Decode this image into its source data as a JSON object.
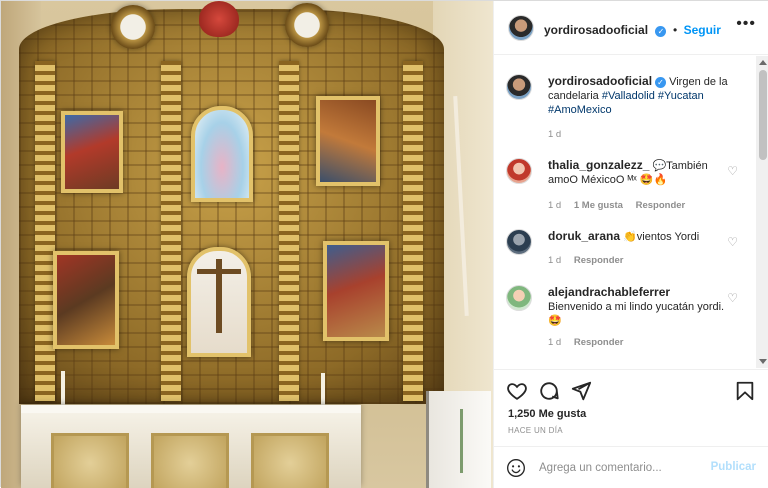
{
  "post": {
    "author": "yordirosadooficial",
    "follow_label": "Seguir",
    "more_label": "•••",
    "caption_prefix": "Virgen de la candelaria ",
    "caption_tags": [
      "#Valladolid",
      "#Yucatan",
      "#AmoMexico"
    ],
    "caption_time": "1 d"
  },
  "comments": [
    {
      "user": "thalia_gonzalezz_",
      "text": "💬También amoO MéxicoO ᴹˣ 🤩🔥",
      "time": "1 d",
      "likes_label": "1 Me gusta",
      "reply_label": "Responder"
    },
    {
      "user": "doruk_arana",
      "text": "👏vientos Yordi",
      "time": "1 d",
      "reply_label": "Responder"
    },
    {
      "user": "alejandrachableferrer",
      "text": "Bienvenido a mi lindo yucatán yordi. 🤩",
      "time": "1 d",
      "reply_label": "Responder"
    }
  ],
  "actions": {
    "likes": "1,250 Me gusta",
    "posted": "HACE UN DÍA",
    "icons": [
      "heart-icon",
      "comment-icon",
      "share-icon",
      "bookmark-icon"
    ]
  },
  "composer": {
    "placeholder": "Agrega un comentario...",
    "publish_label": "Publicar",
    "emoji_icon": "smiley-icon"
  },
  "colors": {
    "accent": "#0095f6",
    "verified": "#3897f0",
    "publish_disabled": "#b2dffc",
    "muted": "#8e8e8e"
  }
}
